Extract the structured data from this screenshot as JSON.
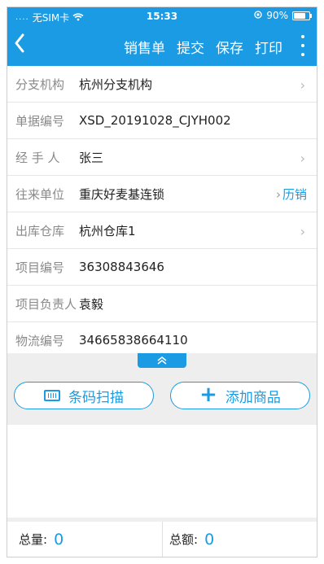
{
  "status_bar": {
    "dots": "....",
    "carrier": "无SIM卡",
    "time": "15:33",
    "battery": "90%",
    "battery_level": 0.9
  },
  "nav": {
    "back_icon": "back-arrow",
    "actions": [
      "销售单",
      "提交",
      "保存",
      "打印"
    ],
    "more_icon": "vertical-dots"
  },
  "form": {
    "rows": [
      {
        "label": "分支机构",
        "value": "杭州分支机构",
        "chevron": true
      },
      {
        "label": "单据编号",
        "value": "XSD_20191028_CJYH002",
        "chevron": false
      },
      {
        "label": "经 手 人",
        "value": "张三",
        "chevron": true
      },
      {
        "label": "往来单位",
        "value": "重庆好麦基连锁",
        "chevron": false,
        "extra": "历销"
      },
      {
        "label": "出库仓库",
        "value": "杭州仓库1",
        "chevron": true
      },
      {
        "label": "项目编号",
        "value": "36308843646",
        "chevron": false
      },
      {
        "label": "项目负责人",
        "value": "袁毅",
        "chevron": false
      },
      {
        "label": "物流编号",
        "value": "34665838664110",
        "chevron": false
      }
    ]
  },
  "actions": {
    "scan_label": "条码扫描",
    "add_label": "添加商品"
  },
  "footer": {
    "qty_label": "总量:",
    "qty_value": "0",
    "amount_label": "总额:",
    "amount_value": "0"
  },
  "colors": {
    "primary": "#1a9be3",
    "background": "#ffffff",
    "band": "#eeeeee"
  }
}
